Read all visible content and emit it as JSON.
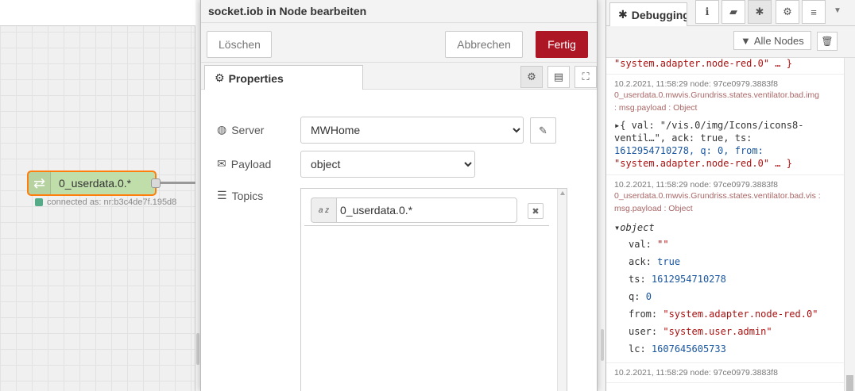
{
  "workspace": {
    "node_label": "0_userdata.0.*",
    "node_status": "connected as: nr:b3c4de7f.195d8"
  },
  "editor": {
    "title": "socket.iob in Node bearbeiten",
    "delete_label": "Löschen",
    "cancel_label": "Abbrechen",
    "done_label": "Fertig",
    "tab_properties": "Properties",
    "server_label": "Server",
    "server_value": "MWHome",
    "payload_label": "Payload",
    "payload_value": "object",
    "topics_label": "Topics",
    "topic_type": "a z",
    "topic_value": "0_userdata.0.*"
  },
  "sidebar": {
    "tab_debug": "Debugging",
    "filter_label": "Alle Nodes",
    "messages": [
      {
        "tail": "\"system.adapter.node-red.0\" … }"
      },
      {
        "meta": "10.2.2021, 11:58:29   node: 97ce0979.3883f8",
        "topic": "0_userdata.0.mwvis.Grundriss.states.ventilator.bad.img",
        "type": ": msg.payload : Object",
        "preview_1": "▸{ val: \"/vis.0/img/Icons/icons8-",
        "preview_2": "ventil…\", ack: true, ts:",
        "preview_3": "1612954710278, q: 0, from:",
        "preview_4": "\"system.adapter.node-red.0\" … }"
      },
      {
        "meta": "10.2.2021, 11:58:29   node: 97ce0979.3883f8",
        "topic": "0_userdata.0.mwvis.Grundriss.states.ventilator.bad.vis :",
        "type": "msg.payload : Object",
        "object_label": "▾object",
        "fields": [
          {
            "key": "val:",
            "value": "\"\"",
            "kind": "str"
          },
          {
            "key": "ack:",
            "value": "true",
            "kind": "bool"
          },
          {
            "key": "ts:",
            "value": "1612954710278",
            "kind": "num"
          },
          {
            "key": "q:",
            "value": "0",
            "kind": "num"
          },
          {
            "key": "from:",
            "value": "\"system.adapter.node-red.0\"",
            "kind": "str"
          },
          {
            "key": "user:",
            "value": "\"system.user.admin\"",
            "kind": "str"
          },
          {
            "key": "lc:",
            "value": "1607645605733",
            "kind": "num"
          }
        ]
      },
      {
        "meta": "10.2.2021, 11:58:29   node: 97ce0979.3883f8"
      }
    ]
  },
  "icons": [
    "arrows-icon",
    "gear-icon",
    "document-icon",
    "frame-icon",
    "pencil-icon",
    "globe-icon",
    "envelope-icon",
    "list-icon",
    "info-icon",
    "book-icon",
    "bug-icon",
    "database-icon",
    "filter-icon",
    "trash-icon",
    "close-icon"
  ]
}
